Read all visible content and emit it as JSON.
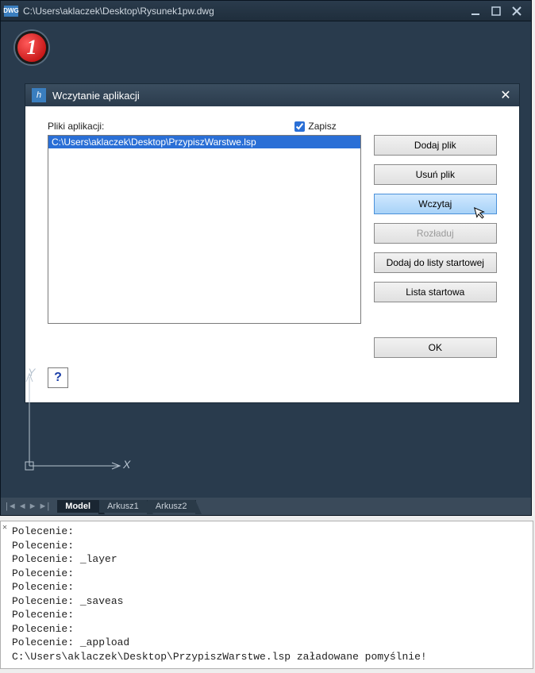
{
  "window": {
    "icon_text": "DWG",
    "title": "C:\\Users\\aklaczek\\Desktop\\Rysunek1pw.dwg"
  },
  "step_badge": "1",
  "dialog": {
    "title": "Wczytanie aplikacji",
    "files_label": "Pliki aplikacji:",
    "save_label": "Zapisz",
    "save_checked": true,
    "selected_file": "C:\\Users\\aklaczek\\Desktop\\PrzypiszWarstwe.lsp",
    "buttons": {
      "add": "Dodaj plik",
      "remove": "Usuń plik",
      "load": "Wczytaj",
      "unload": "Rozładuj",
      "startup_add": "Dodaj do listy startowej",
      "startup_list": "Lista startowa",
      "ok": "OK"
    },
    "help": "?"
  },
  "axis": {
    "x": "X",
    "y": "Y"
  },
  "tabs": {
    "items": [
      "Model",
      "Arkusz1",
      "Arkusz2"
    ],
    "active": 0
  },
  "console": {
    "lines": [
      "Polecenie:",
      "Polecenie:",
      "Polecenie: _layer",
      "Polecenie:",
      "Polecenie:",
      "Polecenie: _saveas",
      "Polecenie:",
      "Polecenie:",
      "Polecenie: _appload",
      "C:\\Users\\aklaczek\\Desktop\\PrzypiszWarstwe.lsp załadowane pomyślnie!"
    ]
  }
}
